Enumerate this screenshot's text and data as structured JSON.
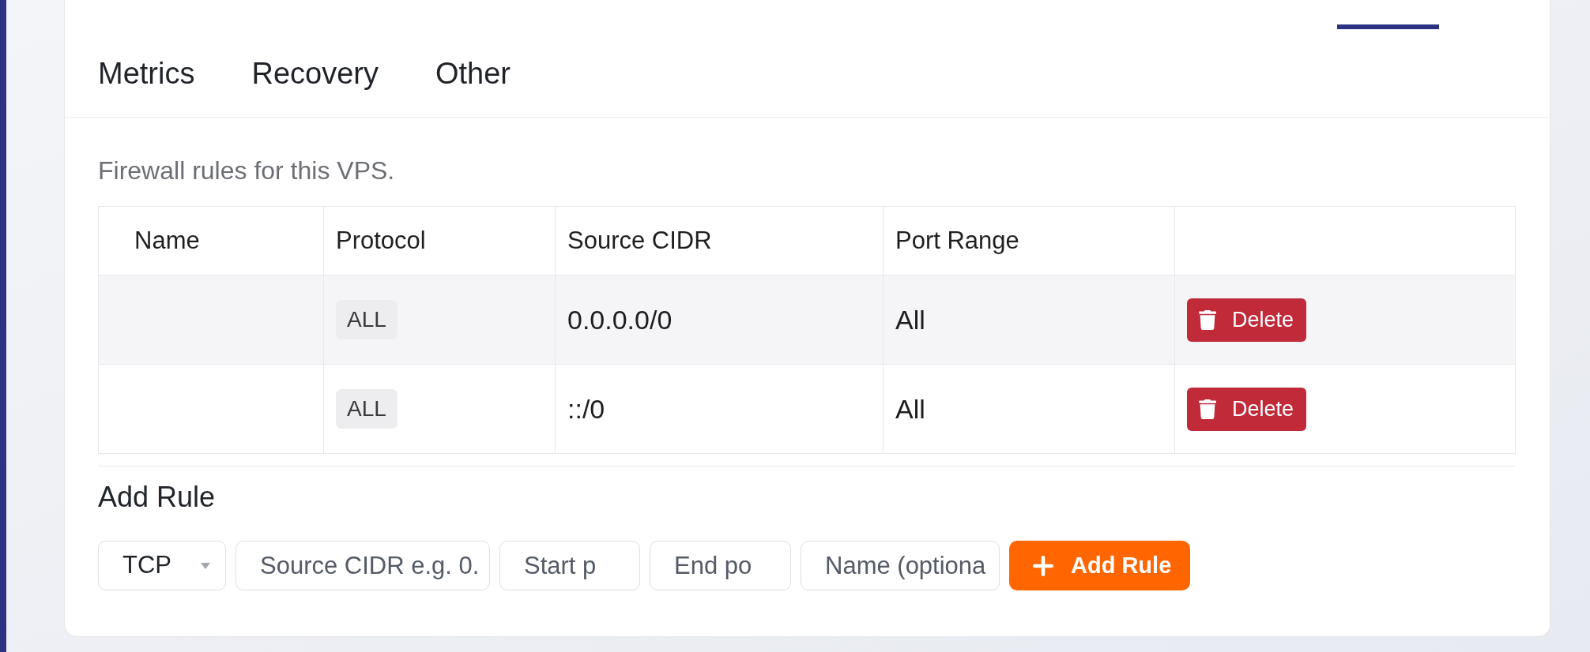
{
  "tabs": [
    {
      "label": "Metrics",
      "selected": false
    },
    {
      "label": "Recovery",
      "selected": false
    },
    {
      "label": "Other",
      "selected": false
    }
  ],
  "description": "Firewall rules for this VPS.",
  "table": {
    "columns": [
      "Name",
      "Protocol",
      "Source CIDR",
      "Port Range"
    ],
    "rows": [
      {
        "protocol": "ALL",
        "source_cidr": "0.0.0.0/0",
        "port_range": "All",
        "action": "Delete"
      },
      {
        "protocol": "ALL",
        "source_cidr": "::/0",
        "port_range": "All",
        "action": "Delete"
      }
    ]
  },
  "add_rule": {
    "title": "Add Rule",
    "protocol": {
      "value": "TCP"
    },
    "fields": [
      {
        "placeholder": "Source CIDR e.g. 0."
      },
      {
        "placeholder": "Start p"
      },
      {
        "placeholder": "End po"
      },
      {
        "placeholder": "Name (optiona"
      }
    ],
    "submit": "Add Rule"
  }
}
